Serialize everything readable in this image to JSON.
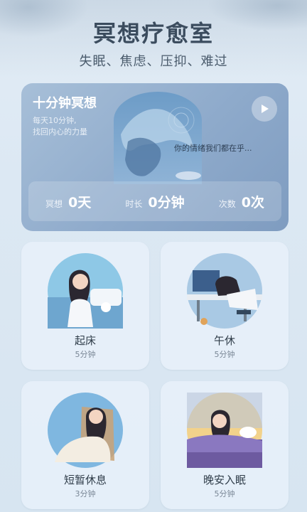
{
  "header": {
    "title": "冥想疗愈室",
    "subtitle": "失眠、焦虑、压抑、难过"
  },
  "hero": {
    "title": "十分钟冥想",
    "desc_line1": "每天10分钟,",
    "desc_line2": "找回内心的力量",
    "quote": "你的情绪我们都在乎...",
    "stats": [
      {
        "label": "冥想",
        "value": "0天"
      },
      {
        "label": "时长",
        "value": "0分钟"
      },
      {
        "label": "次数",
        "value": "0次"
      }
    ]
  },
  "tiles": [
    {
      "name": "起床",
      "duration": "5分钟"
    },
    {
      "name": "午休",
      "duration": "5分钟"
    },
    {
      "name": "短暂休息",
      "duration": "3分钟"
    },
    {
      "name": "晚安入眠",
      "duration": "5分钟"
    }
  ],
  "icons": {
    "play": "play-icon"
  }
}
